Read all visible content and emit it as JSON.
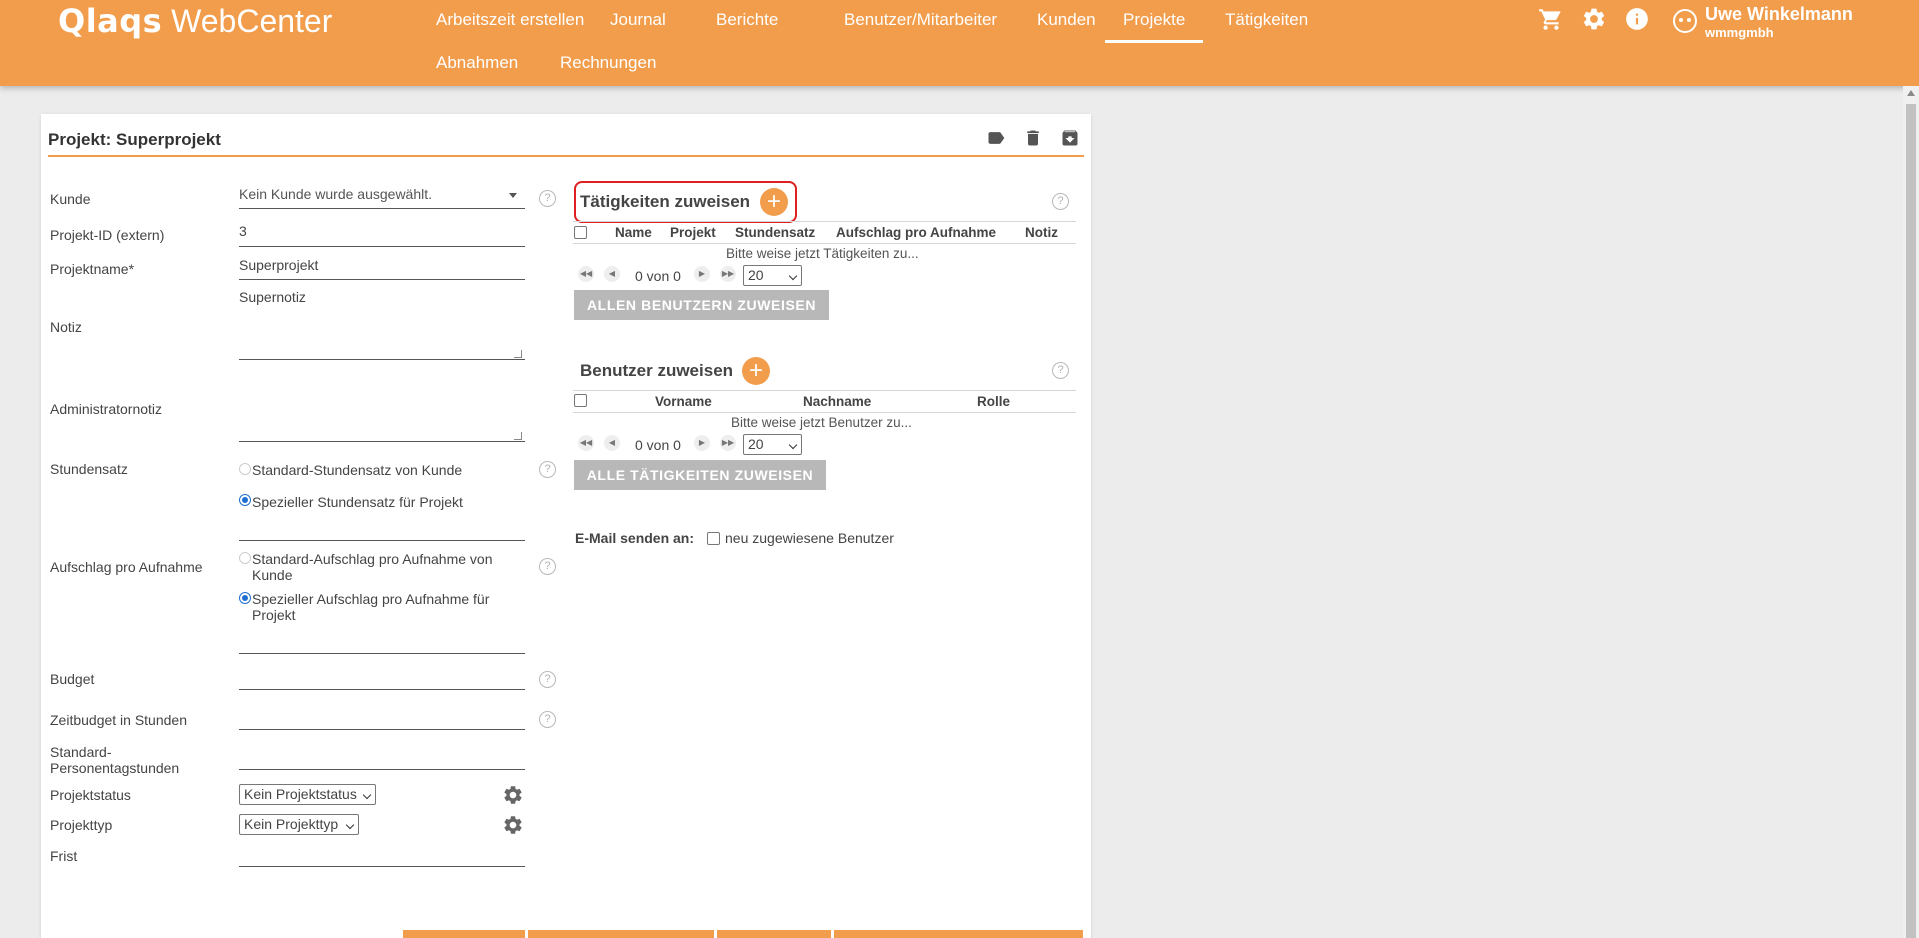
{
  "app": {
    "brand": "Qlaqs",
    "product": "WebCenter"
  },
  "nav": {
    "items": [
      "Arbeitszeit erstellen",
      "Journal",
      "Berichte",
      "Benutzer/Mitarbeiter",
      "Kunden",
      "Projekte",
      "Tätigkeiten",
      "Abnahmen",
      "Rechnungen"
    ],
    "active": "Projekte"
  },
  "header": {
    "icons": [
      "cart-icon",
      "gear-icon",
      "info-icon",
      "user-avatar-icon"
    ],
    "user_name": "Uwe Winkelmann",
    "company": "wmmgmbh"
  },
  "project": {
    "title": "Projekt: Superprojekt",
    "actions": [
      "tag-icon",
      "trash-icon",
      "archive-icon"
    ]
  },
  "form": {
    "kunde_label": "Kunde",
    "kunde_value": "Kein Kunde wurde ausgewählt.",
    "projekt_id_label": "Projekt-ID (extern)",
    "projekt_id_value": "3",
    "projektname_label": "Projektname*",
    "projektname_value": "Superprojekt",
    "notiz_label": "Notiz",
    "notiz_value": "Supernotiz",
    "adminnotiz_label": "Administratornotiz",
    "adminnotiz_value": "",
    "stundensatz_label": "Stundensatz",
    "stundensatz_opt1": "Standard-Stundensatz von Kunde",
    "stundensatz_opt2": "Spezieller Stundensatz für Projekt",
    "stundensatz_selected": "Spezieller Stundensatz für Projekt",
    "aufschlag_label": "Aufschlag pro Aufnahme",
    "aufschlag_opt1": "Standard-Aufschlag pro Aufnahme von Kunde",
    "aufschlag_opt2": "Spezieller Aufschlag pro Aufnahme für Projekt",
    "aufschlag_selected": "Spezieller Aufschlag pro Aufnahme für Projekt",
    "budget_label": "Budget",
    "zeitbudget_label": "Zeitbudget in Stunden",
    "standard_pt_label": "Standard-Personentagstunden",
    "projektstatus_label": "Projektstatus",
    "projektstatus_value": "Kein Projektstatus",
    "projekttyp_label": "Projekttyp",
    "projekttyp_value": "Kein Projekttyp",
    "frist_label": "Frist"
  },
  "taetigkeiten": {
    "title": "Tätigkeiten zuweisen",
    "columns": [
      "Name",
      "Projekt",
      "Stundensatz",
      "Aufschlag pro Aufnahme",
      "Notiz"
    ],
    "empty_message": "Bitte weise jetzt Tätigkeiten zu...",
    "pager_text": "0 von 0",
    "page_size": "20",
    "assign_button": "ALLEN BENUTZERN ZUWEISEN"
  },
  "benutzer": {
    "title": "Benutzer zuweisen",
    "columns": [
      "Vorname",
      "Nachname",
      "Rolle"
    ],
    "empty_message": "Bitte weise jetzt Benutzer zu...",
    "pager_text": "0 von 0",
    "page_size": "20",
    "assign_button": "ALLE TÄTIGKEITEN ZUWEISEN"
  },
  "email": {
    "label": "E-Mail senden an:",
    "checkbox_label": "neu zugewiesene Benutzer"
  },
  "colors": {
    "accent": "#f29d4c",
    "highlight": "#e02020",
    "button_grey": "#b8b8b8"
  }
}
